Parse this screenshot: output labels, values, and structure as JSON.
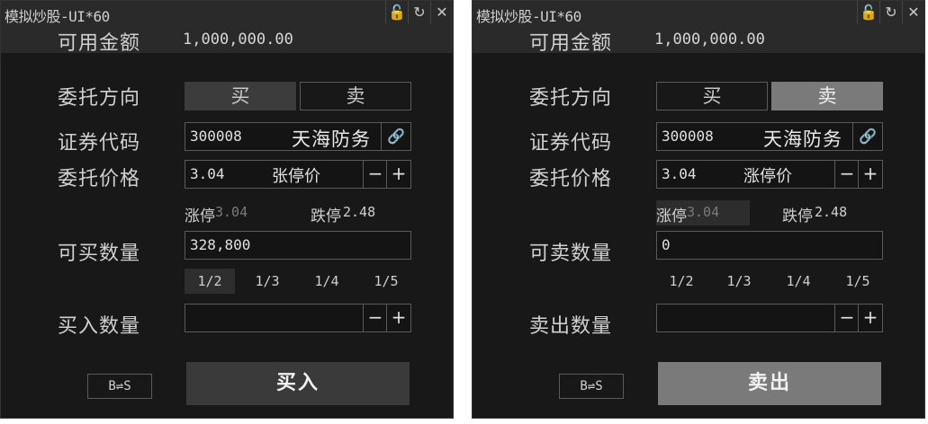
{
  "panels": [
    {
      "title": "模拟炒股-UI*60",
      "balance_label": "可用金额",
      "balance_value": "1,000,000.00",
      "direction_label": "委托方向",
      "buy_label": "买",
      "sell_label": "卖",
      "direction_selected": "买",
      "code_label": "证券代码",
      "code_value": "300008",
      "stock_name": "天海防务",
      "price_label": "委托价格",
      "price_value": "3.04",
      "limit_price_button": "张停价",
      "minus": "−",
      "plus": "+",
      "limit_up_label": "涨停",
      "limit_up_value": "3.04",
      "limit_down_label": "跌停",
      "limit_down_value": "2.48",
      "avail_qty_label": "可买数量",
      "avail_qty_value": "328,800",
      "fractions": [
        "1/2",
        "1/3",
        "1/4",
        "1/5"
      ],
      "order_qty_label": "买入数量",
      "order_qty_value": "",
      "swap_label": "B⇌S",
      "action_label": "买入"
    },
    {
      "title": "模拟炒股-UI*60",
      "balance_label": "可用金额",
      "balance_value": "1,000,000.00",
      "direction_label": "委托方向",
      "buy_label": "买",
      "sell_label": "卖",
      "direction_selected": "卖",
      "code_label": "证券代码",
      "code_value": "300008",
      "stock_name": "天海防务",
      "price_label": "委托价格",
      "price_value": "3.04",
      "limit_price_button": "涨停价",
      "minus": "−",
      "plus": "+",
      "limit_up_label": "涨停",
      "limit_up_value": "3.04",
      "limit_down_label": "跌停",
      "limit_down_value": "2.48",
      "avail_qty_label": "可卖数量",
      "avail_qty_value": "0",
      "fractions": [
        "1/2",
        "1/3",
        "1/4",
        "1/5"
      ],
      "order_qty_label": "卖出数量",
      "order_qty_value": "",
      "swap_label": "B⇌S",
      "action_label": "卖出"
    }
  ],
  "icons": {
    "lock": "lock-icon",
    "refresh": "refresh-icon",
    "close": "close-icon",
    "link": "link-icon"
  },
  "colors": {
    "panel_bg": "#181818",
    "buy_active": "#3c3c3c",
    "sell_active": "#7a7a7a"
  }
}
